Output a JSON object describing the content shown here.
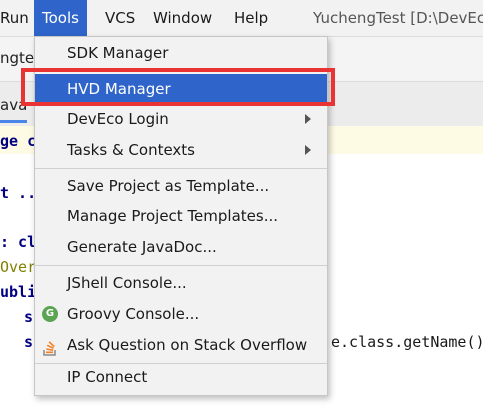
{
  "menubar": {
    "run": "Run",
    "tools": "Tools",
    "vcs": "VCS",
    "window": "Window",
    "help": "Help",
    "title": "YuchengTest [D:\\DevEc"
  },
  "toolbar": {
    "project_text": "ngte"
  },
  "tabs": {
    "java_tab": "ava"
  },
  "code": {
    "line1": "ge c",
    "line2": "t ..",
    "line3": ": cl",
    "line4": "Over",
    "line5": "ubli",
    "line6": "s",
    "line7_prefix": "s",
    "line7_suffix": "e.class.getName()"
  },
  "popup": {
    "items": [
      {
        "label": "SDK Manager"
      },
      {
        "label": "HVD Manager"
      },
      {
        "label": "DevEco Login"
      },
      {
        "label": "Tasks & Contexts"
      },
      {
        "label": "Save Project as Template..."
      },
      {
        "label": "Manage Project Templates..."
      },
      {
        "label": "Generate JavaDoc..."
      },
      {
        "label": "JShell Console..."
      },
      {
        "label": "Groovy Console..."
      },
      {
        "label": "Ask Question on Stack Overflow"
      },
      {
        "label": "IP Connect"
      }
    ],
    "groovy_icon_letter": "G"
  },
  "colors": {
    "selection": "#2f65ca",
    "annotation_box": "#ea3434",
    "current_line": "#fefbe5"
  }
}
